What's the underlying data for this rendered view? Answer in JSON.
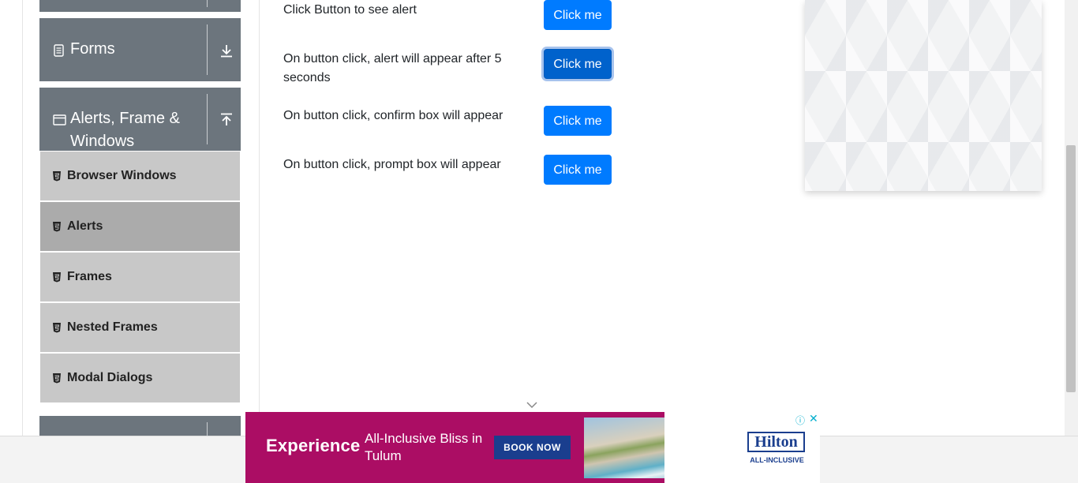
{
  "sidebar": {
    "groups": [
      {
        "label": "Forms"
      },
      {
        "label": "Alerts, Frame &",
        "label_line2": "Windows"
      }
    ],
    "items": [
      {
        "label": "Browser Windows"
      },
      {
        "label": "Alerts"
      },
      {
        "label": "Frames"
      },
      {
        "label": "Nested Frames"
      },
      {
        "label": "Modal Dialogs"
      }
    ]
  },
  "main": {
    "rows": [
      {
        "text": "Click Button to see alert",
        "button": "Click me"
      },
      {
        "text": "On button click, alert will appear after 5 seconds",
        "button": "Click me"
      },
      {
        "text": "On button click, confirm box will appear",
        "button": "Click me"
      },
      {
        "text": "On button click, prompt box will appear",
        "button": "Click me"
      }
    ]
  },
  "ad": {
    "headline": "Experience",
    "tagline": "All-Inclusive Bliss in Tulum",
    "cta": "BOOK NOW",
    "brand": "Hilton",
    "brand_sub": "ALL-INCLUSIVE",
    "adchoices_icon": "info-icon",
    "close_icon": "close-icon"
  },
  "colors": {
    "group_header": "#6c757d",
    "menu_item": "#c8c8c8",
    "menu_item_active": "#ababab",
    "button": "#007bff",
    "banner": "#ab0d64",
    "brand_blue": "#1a3e8e"
  }
}
